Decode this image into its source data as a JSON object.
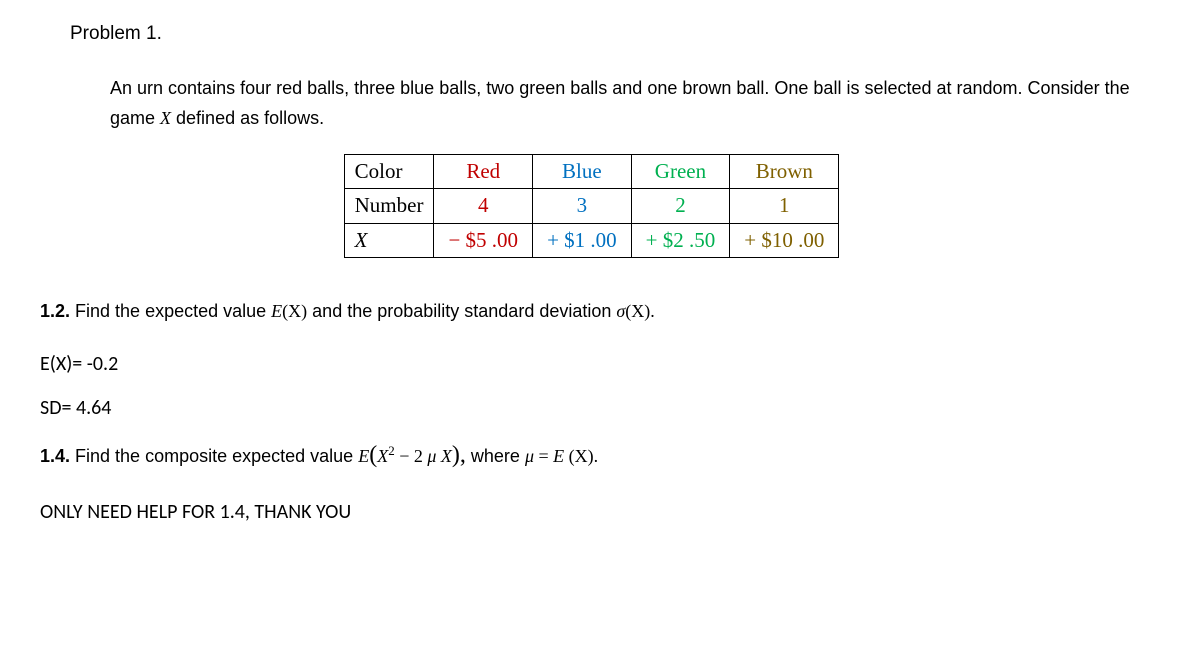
{
  "problem_title": "Problem 1.",
  "problem_text_part1": "An urn contains four red balls, three blue balls, two green balls and one brown ball.  One ball is selected at random.  Consider the game ",
  "problem_text_gameX": "X",
  "problem_text_part2": "  defined as follows.",
  "table": {
    "row1": {
      "hdr": "Color",
      "c1": "Red",
      "c2": "Blue",
      "c3": "Green",
      "c4": "Brown"
    },
    "row2": {
      "hdr": "Number",
      "c1": "4",
      "c2": "3",
      "c3": "2",
      "c4": "1"
    },
    "row3": {
      "hdr": "X",
      "c1": "− $5 .00",
      "c2": "+ $1 .00",
      "c3": "+ $2 .50",
      "c4": "+ $10 .00"
    }
  },
  "q12": {
    "num": "1.2.",
    "text_part1": "  Find the expected value  ",
    "expr1": "E",
    "expr1a": "(X)",
    "text_part2": "  and the probability standard deviation  ",
    "sigma": "σ",
    "expr2": "(X).",
    "ans_ex": "E(X)= -0.2",
    "ans_sd": "SD= 4.64"
  },
  "q14": {
    "num": "1.4.",
    "text_part1": "  Find the composite expected value  ",
    "expr_E": "E",
    "expr_open": "(",
    "expr_X2": "X",
    "expr_sup": "2",
    "expr_minus": " − 2 ",
    "expr_mu": "μ ",
    "expr_X": "X",
    "expr_close": "),",
    "text_part2": "  where  ",
    "mu2": "μ",
    "eq": " = ",
    "E2": "E ",
    "X2b": "(X)."
  },
  "note": "ONLY NEED HELP FOR 1.4, THANK YOU"
}
